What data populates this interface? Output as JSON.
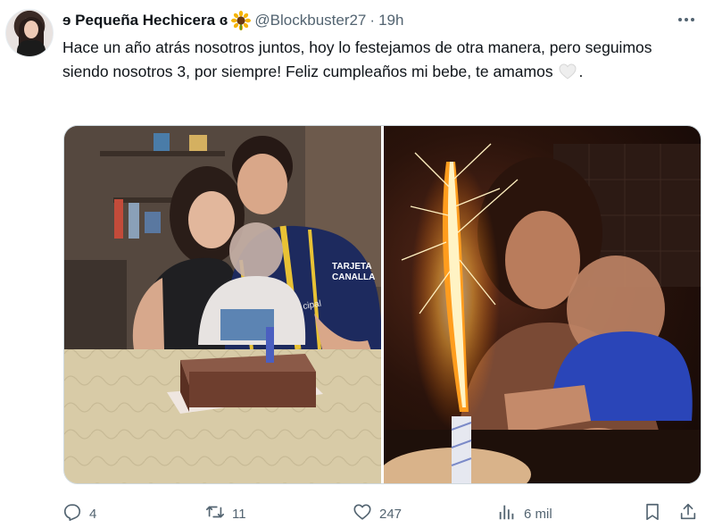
{
  "author": {
    "display_name": "ɘ Pequeña Hechicera ɞ",
    "handle": "@Blockbuster27",
    "separator": "·",
    "time": "19h"
  },
  "tweet": {
    "text_main": "Hace un año atrás nosotros juntos, hoy lo festejamos de otra manera, pero seguimos siendo nosotros 3, por siempre! Feliz cumpleaños mi bebe, te amamos",
    "text_end": "."
  },
  "media": {
    "left": {
      "jersey_text_line1": "TARJETA",
      "jersey_text_line2": "CANALLA",
      "jersey_text_side": "cipal"
    }
  },
  "actions": {
    "replies": "4",
    "retweets": "11",
    "likes": "247",
    "views": "6 mil"
  },
  "colors": {
    "text": "#0f1419",
    "secondary": "#536471",
    "border": "#cfd9de"
  },
  "icons": [
    "sunflower-icon",
    "more-icon",
    "white-heart-icon",
    "reply-icon",
    "retweet-icon",
    "like-icon",
    "views-icon",
    "bookmark-icon",
    "share-icon"
  ]
}
